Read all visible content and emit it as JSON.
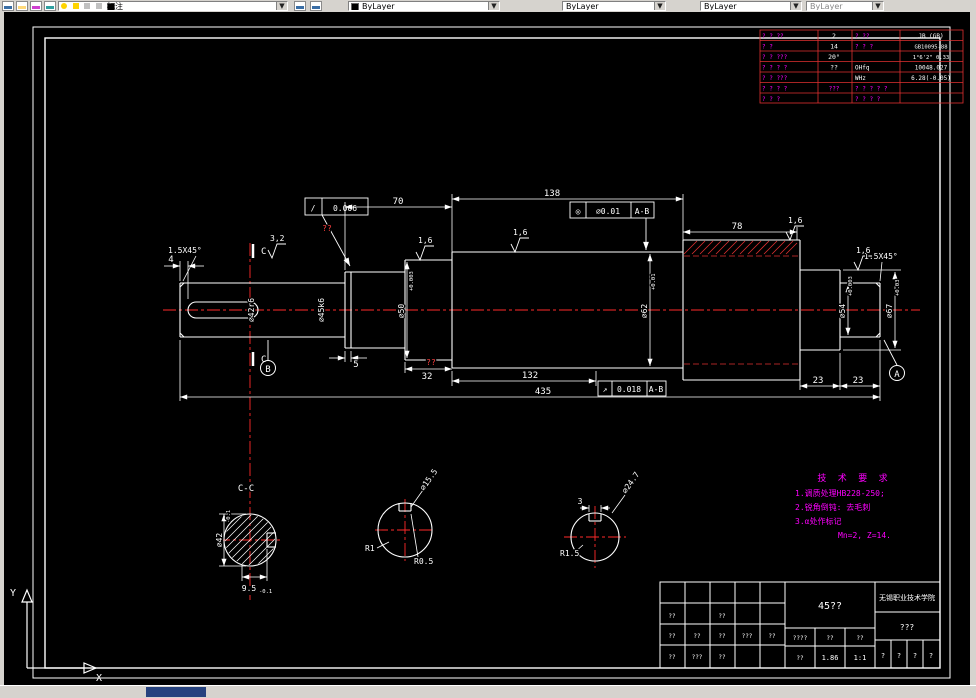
{
  "toolbar": {
    "layer_value": "标注",
    "color_value": "ByLayer",
    "linetype_value": "ByLayer",
    "lineweight_value": "ByLayer",
    "plotstyle_value": "ByLayer"
  },
  "colors": {
    "canvas": "#000000",
    "line": "#ffffff",
    "centerline": "#ff2a2a",
    "table_grid": "#e03030",
    "annotation": "#ff00ff",
    "toolbar_bg": "#d6d3ce"
  },
  "dims": {
    "len4": "4",
    "len5": "5",
    "len23a": "23",
    "len23b": "23",
    "len32": "32",
    "len70": "70",
    "len78": "78",
    "len132": "132",
    "len138": "138",
    "len435": "435",
    "chamfer_left": "1.5X45°",
    "chamfer_right": "1.5X45°",
    "rough1": "1,6",
    "rough2": "1,6",
    "rough3": "1,6",
    "rough4": "1,6",
    "rough_key": "3,2",
    "q1": "??",
    "q2": "??"
  },
  "vdims": {
    "v1": "⌀42r6",
    "v2": "⌀45k6",
    "v3": "⌀50",
    "v3_tol": "+0.003",
    "v4": "⌀62",
    "v4_tol": "+0.01",
    "v5": "⌀54",
    "v5_tol": "+0.003",
    "v6": "⌀67",
    "v6_tol": "+0.03"
  },
  "gdt": {
    "f1_sym": "/",
    "f1_val": "0.006",
    "f2_sym": "◎",
    "f2_val": "⌀0.01",
    "f2_datum": "A-B",
    "f3_sym": "↗",
    "f3_val": "0.018",
    "f3_datum": "A-B"
  },
  "datums": {
    "a": "A",
    "b": "B",
    "c_top": "C",
    "c_bottom": "C"
  },
  "sections": {
    "label": "C-C",
    "s1_bottom": "9.5",
    "s1_bottom_tol": "-0.1",
    "s1_left": "⌀42",
    "s1_left_tol": "-0.1",
    "s2_dia": "⌀15.5",
    "s2_r1": "R1",
    "s2_r2": "R0.5",
    "s3_dia": "⌀24.7",
    "s3_w": "3",
    "s3_r": "R1.5"
  },
  "tech_req": {
    "title": "技 术 要 求",
    "line1": "1.调质处理HB228-250;",
    "line2": "2.锐角倒钝: 去毛刺",
    "line3": "3.α处作标记",
    "line4": "Mn=2, Z=14."
  },
  "gear_table": {
    "rows": [
      {
        "c1": "? ? ??",
        "c2": "2",
        "c3": "? ??",
        "c4": "JB (GB)"
      },
      {
        "c1": "? ?",
        "c2": "14",
        "c3": "? ? ?",
        "c4": "GB10095-88"
      },
      {
        "c1": "? ? ???",
        "c2": "20°",
        "c3": "",
        "c4": "1°6'2\" 0.33"
      },
      {
        "c1": "? ? ? ?",
        "c2": "??",
        "c3": "OHfq",
        "c4": "10048.027"
      },
      {
        "c1": "? ? ???",
        "c2": "",
        "c3": "WHz",
        "c4": "6.28(-0.05)"
      },
      {
        "c1": "? ? ? ?",
        "c2": "???",
        "c3": "? ? ? ? ?",
        "c4": ""
      },
      {
        "c1": "? ? ?",
        "c2": "",
        "c3": "? ? ? ?",
        "c4": ""
      }
    ]
  },
  "title_block": {
    "part_name": "45??",
    "school": "无锡职业技术学院",
    "drawing_no": "???",
    "r2c1": "????",
    "r2c2": "??",
    "r2c3": "??",
    "r3c1": "??",
    "scale1": "1.86",
    "scale2": "1:1",
    "left_rows": {
      "r2a": "??",
      "r2b": "??",
      "r3a": "??",
      "r3b": "??",
      "r3c": "??",
      "r3d": "???",
      "r3e": "??",
      "r4a": "??",
      "r4b": "???",
      "r4c": "??"
    },
    "bottom_cells": {
      "b1": "?",
      "b2": "?",
      "b3": "?",
      "b4": "?"
    }
  },
  "ucs": {
    "x": "X",
    "y": "Y"
  }
}
